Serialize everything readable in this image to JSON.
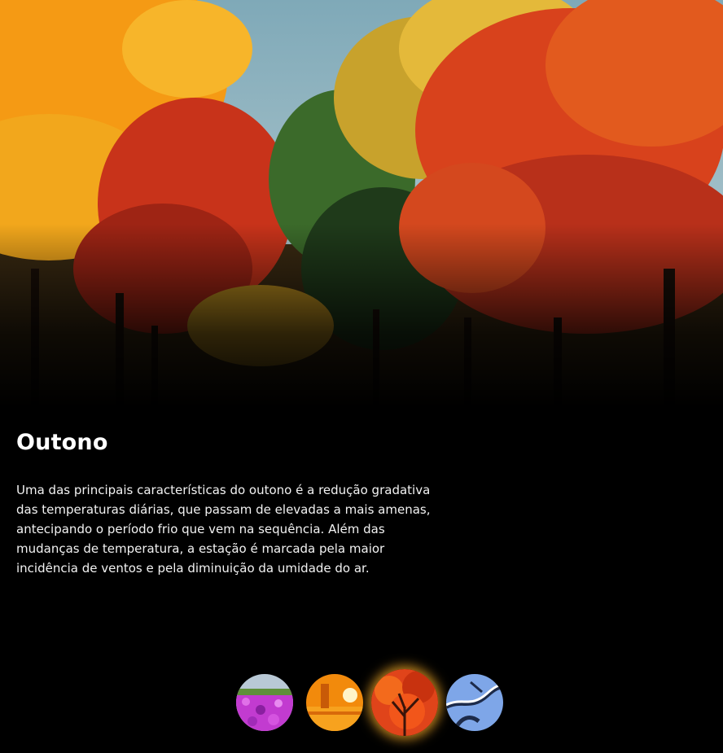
{
  "season": {
    "title": "Outono",
    "description": "Uma das principais características do outono é a redução gradativa das temperaturas diárias, que passam de elevadas a mais amenas, antecipando o período frio que vem na sequência. Além das mudanças de temperatura, a estação é marcada pela maior incidência de ventos e pela diminuição da umidade do ar."
  },
  "thumbnails": [
    {
      "id": "spring",
      "icon": "flower-field-thumbnail",
      "active": false
    },
    {
      "id": "summer",
      "icon": "sunset-thumbnail",
      "active": false
    },
    {
      "id": "autumn",
      "icon": "autumn-tree-thumbnail",
      "active": true
    },
    {
      "id": "winter",
      "icon": "snowy-branches-thumbnail",
      "active": false
    }
  ],
  "colors": {
    "background": "#000000",
    "accent_glow": "#ffb228",
    "text": "#ffffff"
  }
}
